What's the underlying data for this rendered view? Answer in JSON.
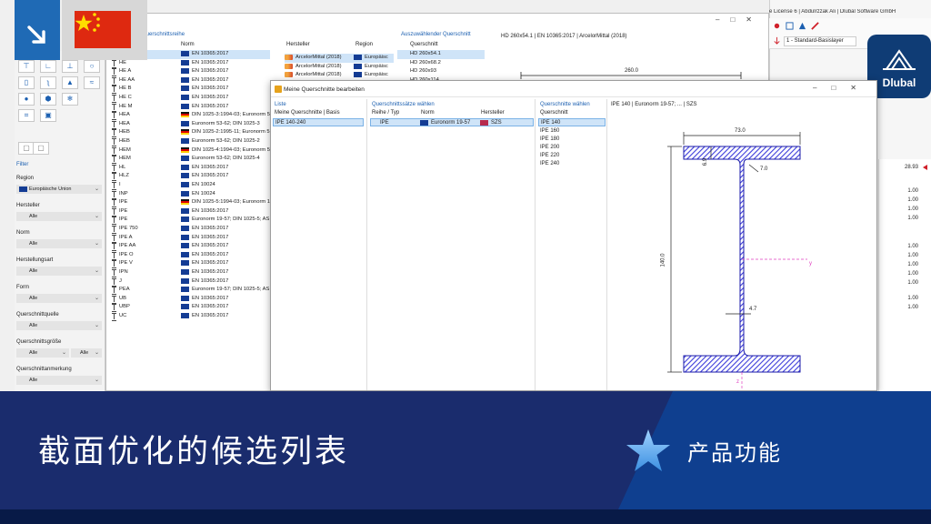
{
  "app": {
    "title": "e License 6 | Abdulrzzak Ali | Dlubal Software GmbH",
    "layer": "1 - Standard-Basislayer",
    "logo_text": "Dlubal",
    "right_values": [
      "28.93",
      "1.00",
      "1.00",
      "1.00",
      "1.00",
      "1.00",
      "1.00",
      "1.00",
      "1.00",
      "1.00",
      "1.00",
      "1.00"
    ]
  },
  "filter": {
    "title": "Filter",
    "fields": [
      {
        "label": "Region",
        "value": "Europäische Union"
      },
      {
        "label": "Hersteller",
        "value": "Alle"
      },
      {
        "label": "Norm",
        "value": "Alle"
      },
      {
        "label": "Herstellungsart",
        "value": "Alle"
      },
      {
        "label": "Form",
        "value": "Alle"
      },
      {
        "label": "Querschnittquelle",
        "value": "Alle"
      },
      {
        "label": "Querschnittsgröße",
        "value": "Alle",
        "value2": "Alle"
      },
      {
        "label": "Querschnittanmerkung",
        "value": "Alle"
      }
    ]
  },
  "series": {
    "title": "e Querschnittsreihe",
    "header_norm": "Norm",
    "header_mfr": "Hersteller",
    "header_region": "Region",
    "rows": [
      {
        "name": "HD",
        "norm": "EN 10365:2017",
        "flag": "eu"
      },
      {
        "name": "HE",
        "norm": "EN 10365:2017",
        "flag": "eu"
      },
      {
        "name": "HE A",
        "norm": "EN 10365:2017",
        "flag": "eu"
      },
      {
        "name": "HE AA",
        "norm": "EN 10365:2017",
        "flag": "eu"
      },
      {
        "name": "HE B",
        "norm": "EN 10365:2017",
        "flag": "eu"
      },
      {
        "name": "HE C",
        "norm": "EN 10365:2017",
        "flag": "eu"
      },
      {
        "name": "HE M",
        "norm": "EN 10365:2017",
        "flag": "eu"
      },
      {
        "name": "HEA",
        "norm": "DIN 1025-3:1994-03; Euronorm 5",
        "flag": "de"
      },
      {
        "name": "HEA",
        "norm": "Euronorm 53-62; DIN 1025-3",
        "flag": "eu"
      },
      {
        "name": "HEB",
        "norm": "DIN 1025-2:1995-11; Euronorm 5",
        "flag": "de"
      },
      {
        "name": "HEB",
        "norm": "Euronorm 53-62; DIN 1025-2",
        "flag": "eu"
      },
      {
        "name": "HEM",
        "norm": "DIN 1025-4:1994-03; Euronorm 5",
        "flag": "de"
      },
      {
        "name": "HEM",
        "norm": "Euronorm 53-62; DIN 1025-4",
        "flag": "eu"
      },
      {
        "name": "HL",
        "norm": "EN 10365:2017",
        "flag": "eu"
      },
      {
        "name": "HLZ",
        "norm": "EN 10365:2017",
        "flag": "eu"
      },
      {
        "name": "I",
        "norm": "EN 10024",
        "flag": "eu"
      },
      {
        "name": "INP",
        "norm": "EN 10024",
        "flag": "eu"
      },
      {
        "name": "IPE",
        "norm": "DIN 1025-5:1994-03; Euronorm 1",
        "flag": "de"
      },
      {
        "name": "IPE",
        "norm": "EN 10365:2017",
        "flag": "eu"
      },
      {
        "name": "IPE",
        "norm": "Euronorm 19-57; DIN 1025-5; AS",
        "flag": "eu"
      },
      {
        "name": "IPE 750",
        "norm": "EN 10365:2017",
        "flag": "eu"
      },
      {
        "name": "IPE A",
        "norm": "EN 10365:2017",
        "flag": "eu"
      },
      {
        "name": "IPE AA",
        "norm": "EN 10365:2017",
        "flag": "eu"
      },
      {
        "name": "IPE O",
        "norm": "EN 10365:2017",
        "flag": "eu"
      },
      {
        "name": "IPE V",
        "norm": "EN 10365:2017",
        "flag": "eu"
      },
      {
        "name": "IPN",
        "norm": "EN 10365:2017",
        "flag": "eu"
      },
      {
        "name": "J",
        "norm": "EN 10365:2017",
        "flag": "eu"
      },
      {
        "name": "PEA",
        "norm": "Euronorm 19-57; DIN 1025-5; AS",
        "flag": "eu"
      },
      {
        "name": "UB",
        "norm": "EN 10365:2017",
        "flag": "eu"
      },
      {
        "name": "UBP",
        "norm": "EN 10365:2017",
        "flag": "eu"
      },
      {
        "name": "UC",
        "norm": "EN 10365:2017",
        "flag": "eu"
      }
    ],
    "manufacturers": [
      {
        "name": "ArcelorMittal (2018)",
        "region": "Europäisc"
      },
      {
        "name": "ArcelorMittal (2018)",
        "region": "Europäisc"
      },
      {
        "name": "ArcelorMittal (2018)",
        "region": "Europäisc"
      },
      {
        "name": "ArcelorMittal (2018)",
        "region": "Europäisc"
      }
    ]
  },
  "pick": {
    "title": "Auszuwählender Querschnitt",
    "header": "Querschnitt",
    "rows": [
      "HD 260x54.1",
      "HD 260x68.2",
      "HD 260x93",
      "HD 260x114"
    ]
  },
  "preview": {
    "title": "HD 260x54.1 | EN 10365:2017 | ArcelorMittal (2018)",
    "dim": "260.0"
  },
  "dialog": {
    "title": "Meine Querschnitte bearbeiten",
    "list": {
      "title": "Liste",
      "header": "Meine Querschnitte | Basis",
      "rows": [
        "IPE 140-240"
      ]
    },
    "sets": {
      "title": "Querschnittssätze wählen",
      "header_type": "Reihe / Typ",
      "header_norm": "Norm",
      "header_mfr": "Hersteller",
      "row": {
        "type": "IPE",
        "norm": "Euronorm 19-57",
        "mfr": "SZS"
      }
    },
    "sections": {
      "title": "Querschnitte wählen",
      "header": "Querschnitt",
      "rows": [
        "IPE 140",
        "IPE 160",
        "IPE 180",
        "IPE 200",
        "IPE 220",
        "IPE 240"
      ]
    },
    "profile": {
      "title": "IPE 140 | Euronorm 19-57; ... | SZS",
      "dim_width": "73.0",
      "dim_flange": "6.9",
      "dim_radius": "7.0",
      "dim_height": "140.0",
      "dim_web": "4.7",
      "axis_y": "y",
      "axis_z": "z"
    }
  },
  "banner": {
    "title": "截面优化的候选列表",
    "subtitle": "产品功能"
  },
  "colors": {
    "banner_dark": "#1a2c6d",
    "banner_accent": "#0f3f8f",
    "selection": "#cfe4f8",
    "accent_blue": "#1b5fb0",
    "hatch": "#3d3ddb"
  }
}
